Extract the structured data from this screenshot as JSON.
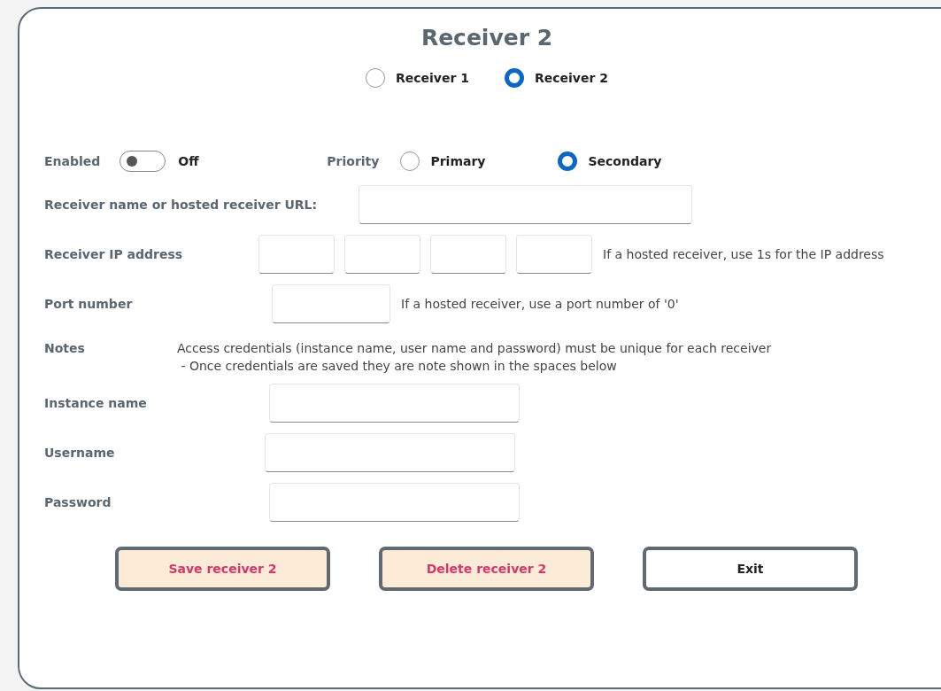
{
  "title": "Receiver 2",
  "receivers": [
    {
      "label": "Receiver 1",
      "selected": false
    },
    {
      "label": "Receiver 2",
      "selected": true
    }
  ],
  "enabled": {
    "label": "Enabled",
    "on": false,
    "state_text": "Off"
  },
  "priority": {
    "label": "Priority",
    "options": [
      {
        "label": "Primary",
        "selected": false
      },
      {
        "label": "Secondary",
        "selected": true
      }
    ]
  },
  "rows": [
    {
      "kind": "url",
      "label": "Receiver name or hosted receiver URL:"
    },
    {
      "kind": "ip",
      "label": "Receiver IP address",
      "hint": "If a hosted receiver, use 1s for the IP address"
    },
    {
      "kind": "port",
      "label": "Port number",
      "hint": "If a hosted receiver, use a port number of '0'"
    },
    {
      "kind": "notes",
      "label": "Notes",
      "lines": [
        "Access credentials (instance name, user name and password) must be unique for each receiver",
        " - Once credentials are saved they are note shown in the spaces below"
      ]
    },
    {
      "kind": "text",
      "label": "Instance name"
    },
    {
      "kind": "text",
      "label": "Username"
    },
    {
      "kind": "password",
      "label": "Password"
    }
  ],
  "buttons": [
    {
      "label": "Save receiver 2",
      "kind": "action"
    },
    {
      "label": "Delete receiver 2",
      "kind": "action"
    },
    {
      "label": "Exit",
      "kind": "plain"
    }
  ]
}
